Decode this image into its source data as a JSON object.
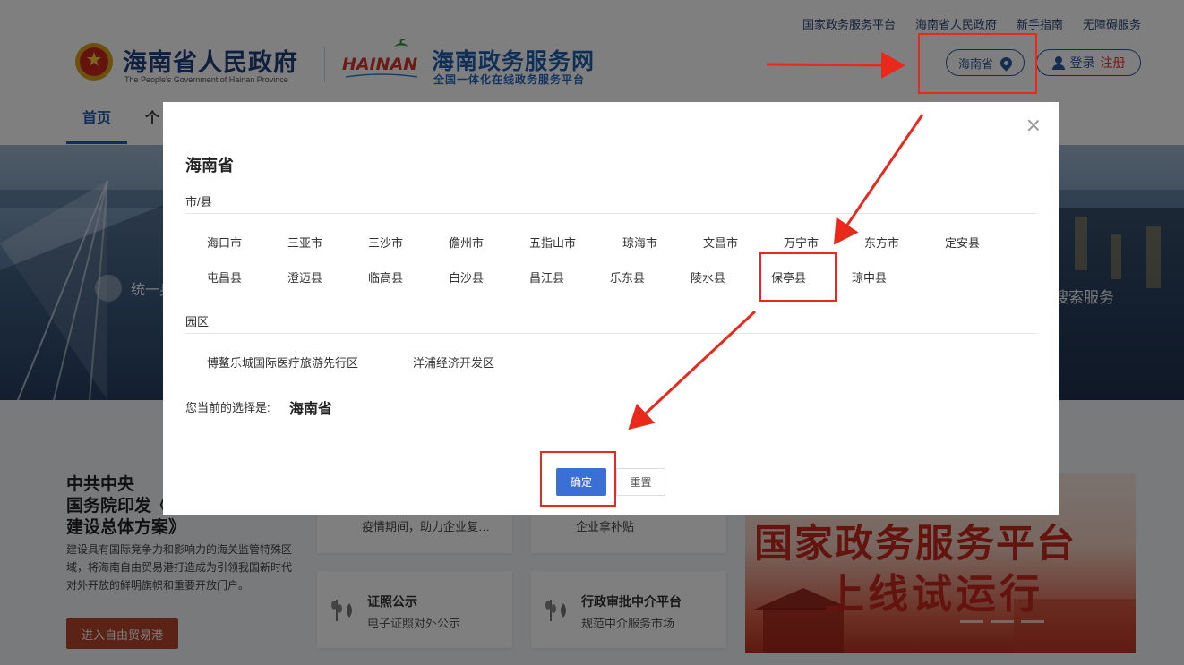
{
  "header": {
    "top_links": [
      "国家政务服务平台",
      "海南省人民政府",
      "新手指南",
      "无障碍服务"
    ],
    "gov_title": "海南省人民政府",
    "gov_subtitle": "The People's Government of Hainan Province",
    "hainan_logo_text": "HAINAN",
    "service_title": "海南政务服务网",
    "service_subtitle": "全国一体化在线政务服务平台",
    "location_label": "海南省",
    "login_label": "登录",
    "register_label": "注册",
    "nav": [
      "首页",
      "个"
    ]
  },
  "banner": {
    "service_text": "统一身",
    "search_text": "搜索服务"
  },
  "news": {
    "title": "中共中央\n国务院印发《\n建设总体方案》",
    "desc": "建设具有国际竞争力和影响力的海关监管特殊区域，将海南自由贸易港打造成为引领我国新时代对外开放的鲜明旗帜和重要开放门户。",
    "button": "进入自由贸易港"
  },
  "cards": [
    {
      "title": "",
      "subtitle": "疫情期间，助力企业复…"
    },
    {
      "title": "",
      "subtitle": "企业拿补贴"
    },
    {
      "title": "证照公示",
      "subtitle": "电子证照对外公示"
    },
    {
      "title": "行政审批中介平台",
      "subtitle": "规范中介服务市场"
    }
  ],
  "promo": {
    "line1": "国家政务服务平台",
    "line2": "上线试运行"
  },
  "modal": {
    "title": "海南省",
    "cities_label": "市/县",
    "cities_row1": [
      "海口市",
      "三亚市",
      "三沙市",
      "儋州市",
      "五指山市",
      "琼海市",
      "文昌市",
      "万宁市",
      "东方市",
      "定安县"
    ],
    "cities_row2": [
      "屯昌县",
      "澄迈县",
      "临高县",
      "白沙县",
      "昌江县",
      "乐东县",
      "陵水县",
      "保亭县",
      "琼中县"
    ],
    "parks_label": "园区",
    "parks": [
      "博鳌乐城国际医疗旅游先行区",
      "洋浦经济开发区"
    ],
    "current_label": "您当前的选择是:",
    "current_value": "海南省",
    "confirm_label": "确定",
    "reset_label": "重置"
  },
  "colors": {
    "primary_blue": "#3b6fd5",
    "annotation_red": "#e8291c",
    "nav_blue": "#1f5fae"
  }
}
